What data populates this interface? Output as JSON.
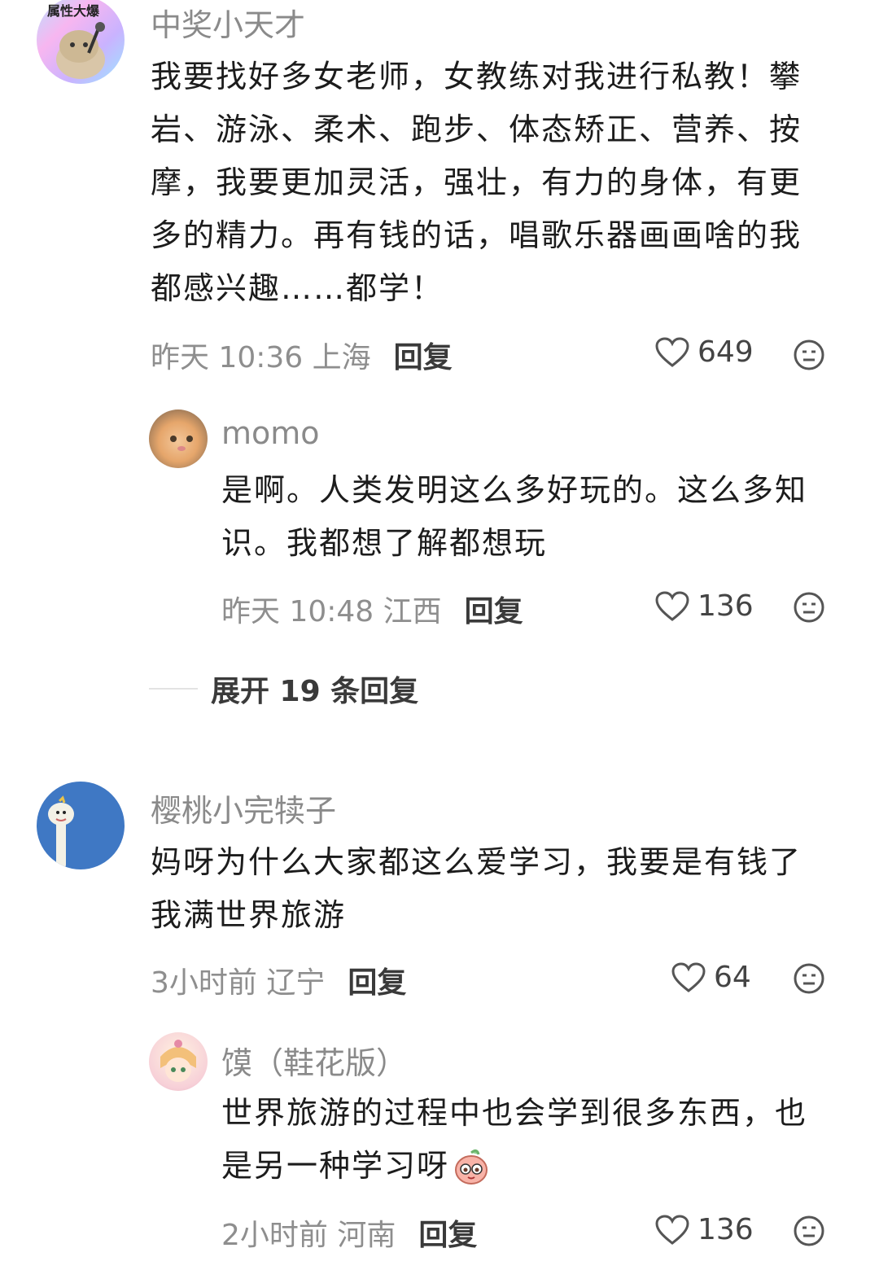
{
  "comments": [
    {
      "name": "中奖小天才",
      "avatar_text": "属性大爆",
      "text_lines": [
        "我要找好多女老师，女教练对我进行私教！攀",
        "岩、游泳、柔术、跑步、体态矫正、营养、按",
        "摩，我要更加灵活，强壮，有力的身体，有更",
        "多的精力。再有钱的话，唱歌乐器画画啥的我",
        "都感兴趣……都学！"
      ],
      "time": "昨天 10:36 上海",
      "reply_label": "回复",
      "likes": "649",
      "replies": [
        {
          "name": "momo",
          "text_lines": [
            "是啊。人类发明这么多好玩的。这么多知",
            "识。我都想了解都想玩"
          ],
          "time": "昨天 10:48 江西",
          "reply_label": "回复",
          "likes": "136"
        }
      ],
      "expand_label": "展开 19 条回复"
    },
    {
      "name": "樱桃小完犊子",
      "text_lines": [
        "妈呀为什么大家都这么爱学习，我要是有钱了",
        "我满世界旅游"
      ],
      "time": "3小时前 辽宁",
      "reply_label": "回复",
      "likes": "64",
      "replies": [
        {
          "name": "馍（鞋花版）",
          "text_lines": [
            "世界旅游的过程中也会学到很多东西，也",
            "是另一种学习呀"
          ],
          "time": "2小时前 河南",
          "reply_label": "回复",
          "likes": "136"
        }
      ]
    }
  ]
}
